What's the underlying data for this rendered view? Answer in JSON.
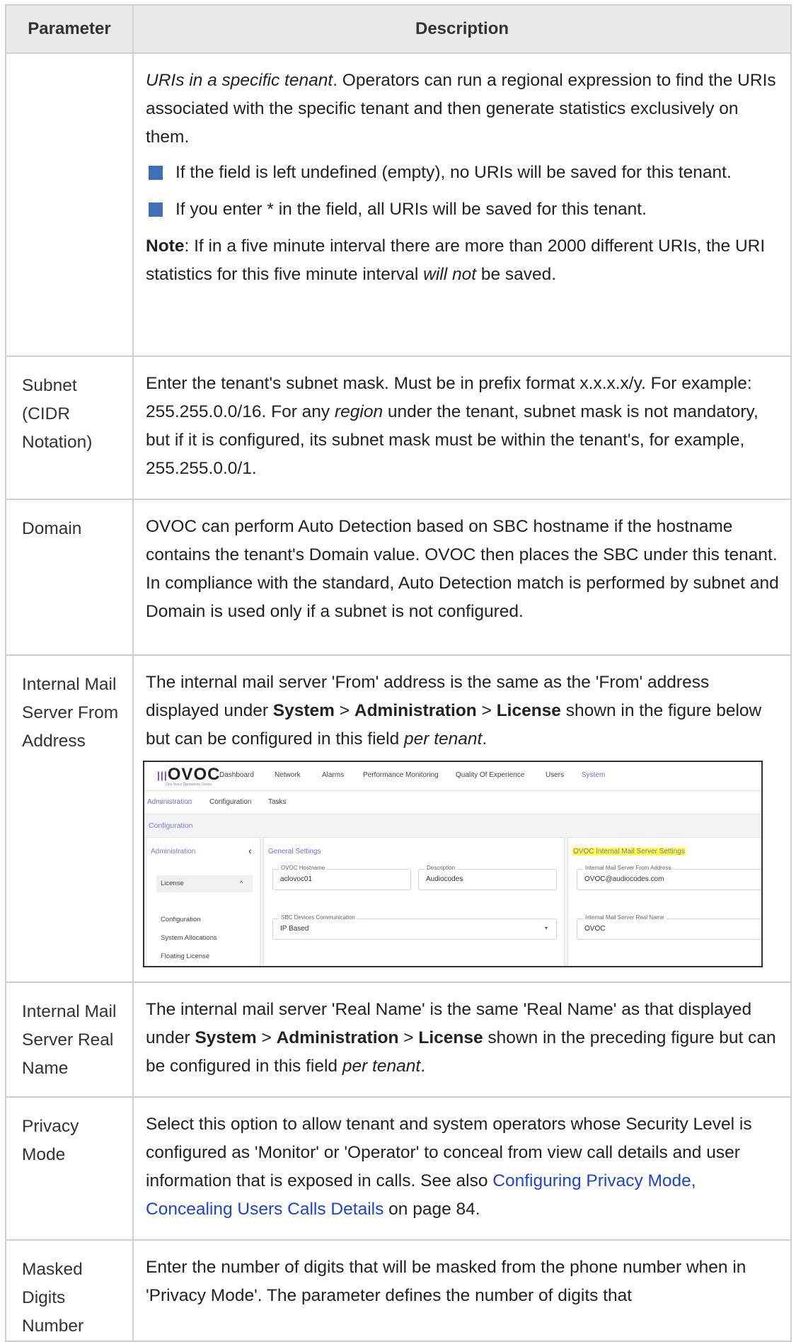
{
  "table": {
    "header": {
      "parameter": "Parameter",
      "description": "Description"
    },
    "row_uri": {
      "p1_italic": "URIs in a specific tenant",
      "p1_rest": ". Operators can run a regional expression to find the URIs associated with the specific tenant and then generate statistics exclusively on them.",
      "bullet1": "If the field is left undefined (empty), no URIs will be saved for this tenant.",
      "bullet2": "If you enter * in the field, all URIs will be saved for this tenant.",
      "note_label": "Note",
      "note_a": ": If in a five minute interval there are more than 2000 different URIs, the URI statistics for this five minute interval ",
      "note_italic": "will not",
      "note_b": " be saved."
    },
    "row_subnet": {
      "param": "Subnet (CIDR Notation)",
      "d_a": "Enter the tenant's subnet mask. Must be in prefix format x.x.x.x/y. For example: 255.255.0.0/16. For any ",
      "d_italic": "region",
      "d_b": " under the tenant, subnet mask is not mandatory, but if it is configured, its subnet mask must be within the tenant's, for example, 255.255.0.0/1."
    },
    "row_domain": {
      "param": "Domain",
      "desc": "OVOC can perform Auto Detection based on SBC hostname if the hostname contains the tenant's Domain value. OVOC then places the SBC under this tenant. In compliance with the standard, Auto Detection match is performed by subnet and Domain is used only if a subnet is not configured."
    },
    "row_from": {
      "param": "Internal Mail Server From Address",
      "d_a": "The internal mail server 'From' address is the same as the 'From' address displayed under ",
      "b1": "System",
      "sep1": " > ",
      "b2": "Administration",
      "sep2": " > ",
      "b3": "License",
      "d_b": " shown in the figure below but can be configured in this field ",
      "d_italic": "per tenant",
      "d_c": "."
    },
    "row_realname": {
      "param": "Internal Mail Server Real Name",
      "d_a": "The internal mail server 'Real Name' is the same 'Real Name' as that displayed under ",
      "b1": "System",
      "sep1": " > ",
      "b2": "Administration",
      "sep2": " > ",
      "b3": "License",
      "d_b": " shown in the preceding figure but can be configured in this field ",
      "d_italic": "per tenant",
      "d_c": "."
    },
    "row_privacy": {
      "param": "Privacy Mode",
      "d_a": "Select this option to allow tenant and system operators whose Security Level is configured as 'Monitor' or 'Operator' to conceal from view call details and user information that is exposed in calls. See also ",
      "link": "Configuring Privacy Mode, Concealing Users Calls Details",
      "d_b": " on page 84."
    },
    "row_masked": {
      "param": "Masked Digits Number",
      "desc": "Enter the number of digits that will be masked from the phone number when in 'Privacy Mode'. The parameter defines the number of digits that"
    }
  },
  "screenshot": {
    "logo": "OVOC",
    "logo_sub": "One Voice Operations Center",
    "nav": [
      "Dashboard",
      "Network",
      "Alarms",
      "Performance Monitoring",
      "Quality Of Experience",
      "Users",
      "System"
    ],
    "subnav": [
      "Administration",
      "Configuration",
      "Tasks"
    ],
    "breadcrumb": "Configuration",
    "left_title": "Administration",
    "collapse_glyph": "‹",
    "menu_license": "License",
    "expand_glyph": "^",
    "menu_items": [
      "Configuration",
      "System Allocations",
      "Floating License"
    ],
    "general_title": "General Settings",
    "hostname_label": "OVOC Hostname",
    "hostname_value": "aclovoc01",
    "description_label": "Description",
    "description_value": "Audiocodes",
    "sbc_label": "SBC Devices Communication",
    "sbc_value": "IP Based",
    "dropdown_glyph": "▾",
    "mail_title": "OVOC Internal Mail Server Settings",
    "from_label": "Internal Mail Server From Address",
    "from_value": "OVOC@audiocodes.com",
    "realname_label": "Internal Mail Server Real Name",
    "realname_value": "OVOC",
    "colors": {
      "accent": "#6f6ee8",
      "highlight": "#ffff3a"
    }
  },
  "colors": {
    "bullet": "#3f6fb4",
    "link": "#1a43d8",
    "header_bg": "#e9e9e9",
    "border": "#cfcfcf"
  }
}
